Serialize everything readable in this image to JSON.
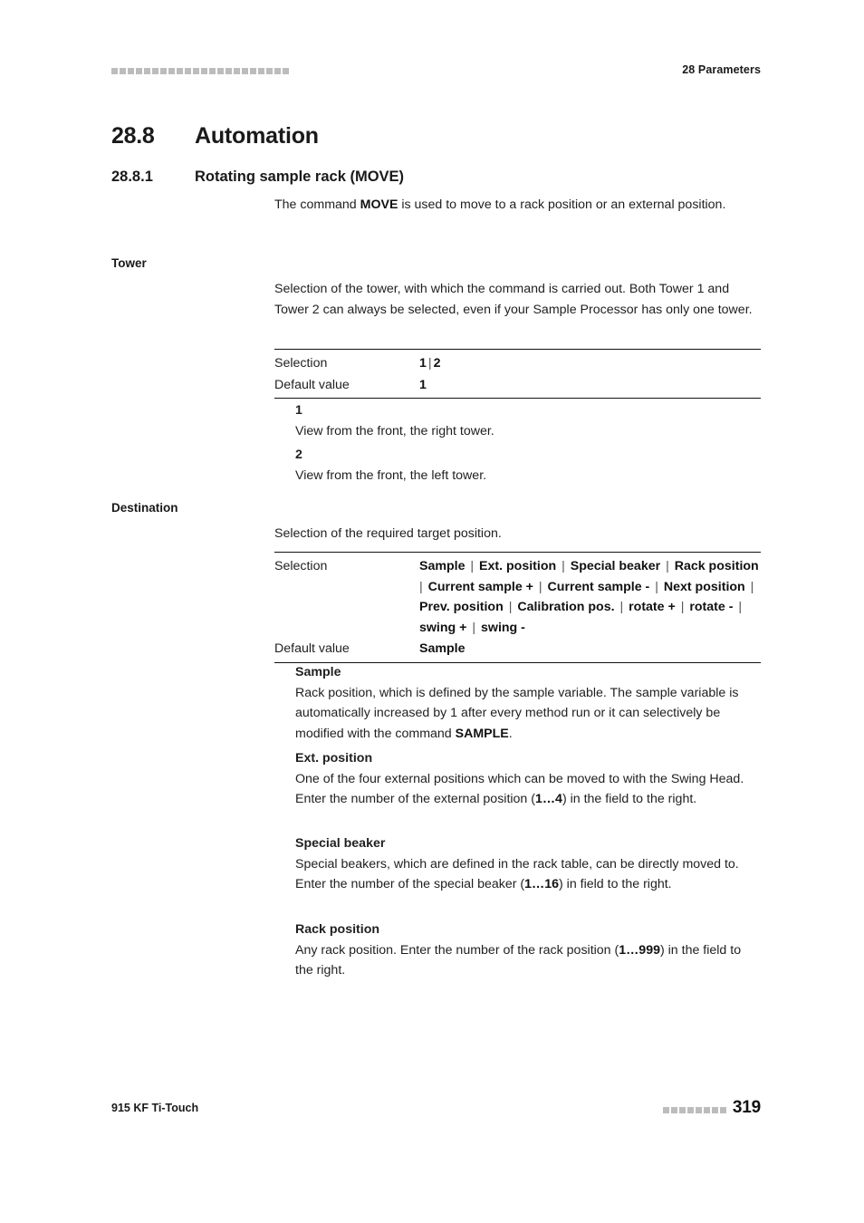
{
  "header": {
    "dash_count": 22,
    "title": "28 Parameters"
  },
  "section": {
    "number": "28.8",
    "title": "Automation"
  },
  "subsection": {
    "number": "28.8.1",
    "title": "Rotating sample rack (MOVE)",
    "intro_prefix": "The command ",
    "intro_bold": "MOVE",
    "intro_suffix": " is used to move to a rack position or an external position."
  },
  "tower": {
    "label": "Tower",
    "description": "Selection of the tower, with which the command is carried out. Both Tower 1 and Tower 2 can always be selected, even if your Sample Processor has only one tower.",
    "table": {
      "selection_label": "Selection",
      "selection_value_1": "1",
      "selection_separator": "|",
      "selection_value_2": "2",
      "default_label": "Default value",
      "default_value": "1"
    },
    "options": [
      {
        "term": "1",
        "text": "View from the front, the right tower."
      },
      {
        "term": "2",
        "text": "View from the front, the left tower."
      }
    ]
  },
  "destination": {
    "label": "Destination",
    "description": "Selection of the required target position.",
    "table": {
      "selection_label": "Selection",
      "selection_values": [
        "Sample",
        "Ext. position",
        "Special beaker",
        "Rack position",
        "Current sample +",
        "Current sample -",
        "Next position",
        "Prev. position",
        "Calibration pos.",
        "rotate +",
        "rotate -",
        "swing +",
        "swing -"
      ],
      "selection_separator": "|",
      "default_label": "Default value",
      "default_value": "Sample"
    },
    "options": [
      {
        "term": "Sample",
        "parts": [
          {
            "t": "Rack position, which is defined by the sample variable. The sample variable is automatically increased by 1 after every method run or it can selectively be modified with the command ",
            "b": false
          },
          {
            "t": "SAMPLE",
            "b": true
          },
          {
            "t": ".",
            "b": false
          }
        ]
      },
      {
        "term": "Ext. position",
        "parts": [
          {
            "t": "One of the four external positions which can be moved to with the Swing Head. Enter the number of the external position (",
            "b": false
          },
          {
            "t": "1…4",
            "b": true
          },
          {
            "t": ") in the field to the right.",
            "b": false
          }
        ]
      },
      {
        "term": "Special beaker",
        "parts": [
          {
            "t": "Special beakers, which are defined in the rack table, can be directly moved to. Enter the number of the special beaker (",
            "b": false
          },
          {
            "t": "1…16",
            "b": true
          },
          {
            "t": ") in field to the right.",
            "b": false
          }
        ]
      },
      {
        "term": "Rack position",
        "parts": [
          {
            "t": "Any rack position. Enter the number of the rack position (",
            "b": false
          },
          {
            "t": "1…999",
            "b": true
          },
          {
            "t": ") in the field to the right.",
            "b": false
          }
        ]
      }
    ]
  },
  "footer": {
    "left": "915 KF Ti-Touch",
    "dash_count": 8,
    "page_number": "319"
  },
  "colors": {
    "text": "#1a1a1a",
    "dash": "#bcbcbc",
    "rule": "#111111"
  }
}
